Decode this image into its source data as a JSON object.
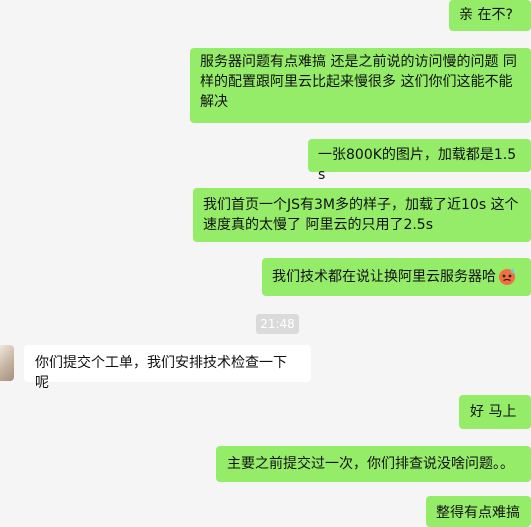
{
  "messages": [
    {
      "text": "亲 在不?"
    },
    {
      "text": "服务器问题有点难搞  还是之前说的访问慢的问题 同样的配置跟阿里云比起来慢很多  这们你们这能不能解决"
    },
    {
      "text": "一张800K的图片，加载都是1.5s"
    },
    {
      "text": "我们首页一个JS有3M多的样子，加载了近10s  这个速度真的太慢了  阿里云的只用了2.5s"
    },
    {
      "text": "我们技术都在说让换阿里云服务器哈"
    },
    {
      "text": "你们提交个工单，我们安排技术检查一下呢"
    },
    {
      "text": "好  马上"
    },
    {
      "text": "主要之前提交过一次，你们排查说没啥问题。。"
    },
    {
      "text": "整得有点难搞"
    }
  ],
  "timestamp": "21:48",
  "emoji_icon": "sweating-face-icon",
  "colors": {
    "self_bubble": "#95ec69",
    "other_bubble": "#ffffff",
    "background": "#f5f5f5",
    "timestamp_bg": "#dadada"
  }
}
